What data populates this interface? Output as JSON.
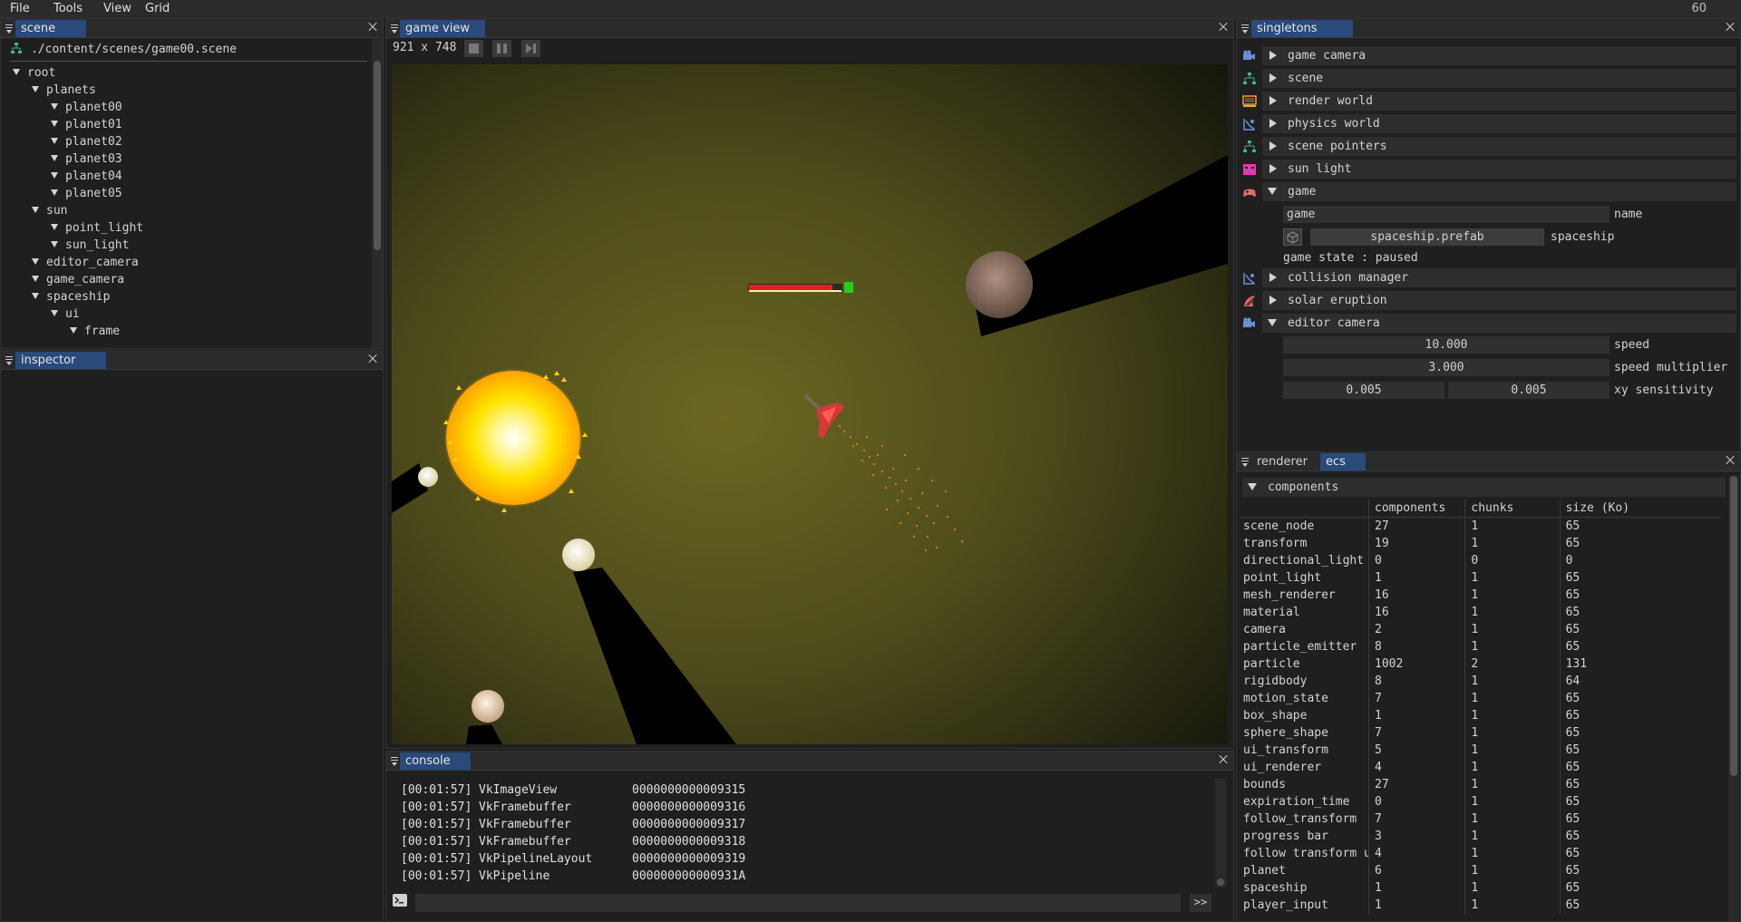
{
  "menu": {
    "file": "File",
    "tools": "Tools",
    "view": "View",
    "grid": "Grid",
    "fps": "60"
  },
  "scene_panel": {
    "tab": "scene",
    "path": "./content/scenes/game00.scene",
    "nodes": [
      {
        "label": "root",
        "depth": 0
      },
      {
        "label": "planets",
        "depth": 1
      },
      {
        "label": "planet00",
        "depth": 2
      },
      {
        "label": "planet01",
        "depth": 2
      },
      {
        "label": "planet02",
        "depth": 2
      },
      {
        "label": "planet03",
        "depth": 2
      },
      {
        "label": "planet04",
        "depth": 2
      },
      {
        "label": "planet05",
        "depth": 2
      },
      {
        "label": "sun",
        "depth": 1
      },
      {
        "label": "point_light",
        "depth": 2
      },
      {
        "label": "sun_light",
        "depth": 2
      },
      {
        "label": "editor_camera",
        "depth": 1
      },
      {
        "label": "game_camera",
        "depth": 1
      },
      {
        "label": "spaceship",
        "depth": 1
      },
      {
        "label": "ui",
        "depth": 2
      },
      {
        "label": "frame",
        "depth": 3
      }
    ]
  },
  "inspector_panel": {
    "tab": "inspector"
  },
  "game_view": {
    "tab": "game view",
    "resolution": "921 x 748"
  },
  "console": {
    "tab": "console",
    "lines": [
      {
        "time": "[00:01:57]",
        "type": "VkImageView",
        "handle": "0000000000009315"
      },
      {
        "time": "[00:01:57]",
        "type": "VkFramebuffer",
        "handle": "0000000000009316"
      },
      {
        "time": "[00:01:57]",
        "type": "VkFramebuffer",
        "handle": "0000000000009317"
      },
      {
        "time": "[00:01:57]",
        "type": "VkFramebuffer",
        "handle": "0000000000009318"
      },
      {
        "time": "[00:01:57]",
        "type": "VkPipelineLayout",
        "handle": "0000000000009319"
      },
      {
        "time": "[00:01:57]",
        "type": "VkPipeline",
        "handle": "000000000000931A"
      }
    ],
    "submit": ">>",
    "input": ""
  },
  "singletons": {
    "tab": "singletons",
    "rows": [
      {
        "label": "game camera",
        "icon": "camera-icon",
        "color": "#6a8fd6",
        "open": false
      },
      {
        "label": "scene",
        "icon": "hierarchy-icon",
        "color": "#3fb58a",
        "open": false
      },
      {
        "label": "render world",
        "icon": "monitor-icon",
        "color": "#e8a23a",
        "open": false
      },
      {
        "label": "physics world",
        "icon": "physics-icon",
        "color": "#6a8fd6",
        "open": false
      },
      {
        "label": "scene pointers",
        "icon": "hierarchy-icon",
        "color": "#3fb58a",
        "open": false
      },
      {
        "label": "sun light",
        "icon": "light-icon",
        "color": "#e03ab0",
        "open": false
      },
      {
        "label": "game",
        "icon": "gamepad-icon",
        "color": "#e06a6a",
        "open": true
      }
    ],
    "game": {
      "name_value": "game",
      "name_label": "name",
      "prefab_value": "spaceship.prefab",
      "prefab_label": "spaceship",
      "state": "game state : paused"
    },
    "rows2": [
      {
        "label": "collision manager",
        "icon": "physics-icon",
        "color": "#6a8fd6",
        "open": false
      },
      {
        "label": "solar eruption",
        "icon": "eruption-icon",
        "color": "#e06a6a",
        "open": false
      },
      {
        "label": "editor camera",
        "icon": "camera-icon",
        "color": "#6a8fd6",
        "open": true
      }
    ],
    "editor_camera": {
      "speed": "10.000",
      "speed_label": "speed",
      "speed_mult": "3.000",
      "speed_mult_label": "speed multiplier",
      "xy_x": "0.005",
      "xy_y": "0.005",
      "xy_label": "xy sensitivity"
    }
  },
  "ecs": {
    "tab_renderer": "renderer",
    "tab_ecs": "ecs",
    "section": "components",
    "headers": [
      "",
      "components",
      "chunks",
      "size (Ko)"
    ],
    "rows": [
      [
        "scene_node",
        "27",
        "1",
        "65"
      ],
      [
        "transform",
        "19",
        "1",
        "65"
      ],
      [
        "directional_light",
        "0",
        "0",
        "0"
      ],
      [
        "point_light",
        "1",
        "1",
        "65"
      ],
      [
        "mesh_renderer",
        "16",
        "1",
        "65"
      ],
      [
        "material",
        "16",
        "1",
        "65"
      ],
      [
        "camera",
        "2",
        "1",
        "65"
      ],
      [
        "particle_emitter",
        "8",
        "1",
        "65"
      ],
      [
        "particle",
        "1002",
        "2",
        "131"
      ],
      [
        "rigidbody",
        "8",
        "1",
        "64"
      ],
      [
        "motion_state",
        "7",
        "1",
        "65"
      ],
      [
        "box_shape",
        "1",
        "1",
        "65"
      ],
      [
        "sphere_shape",
        "7",
        "1",
        "65"
      ],
      [
        "ui_transform",
        "5",
        "1",
        "65"
      ],
      [
        "ui_renderer",
        "4",
        "1",
        "65"
      ],
      [
        "bounds",
        "27",
        "1",
        "65"
      ],
      [
        "expiration_time",
        "0",
        "1",
        "65"
      ],
      [
        "follow_transform",
        "7",
        "1",
        "65"
      ],
      [
        "progress bar",
        "3",
        "1",
        "65"
      ],
      [
        "follow transform ui",
        "4",
        "1",
        "65"
      ],
      [
        "planet",
        "6",
        "1",
        "65"
      ],
      [
        "spaceship",
        "1",
        "1",
        "65"
      ],
      [
        "player_input",
        "1",
        "1",
        "65"
      ]
    ]
  }
}
